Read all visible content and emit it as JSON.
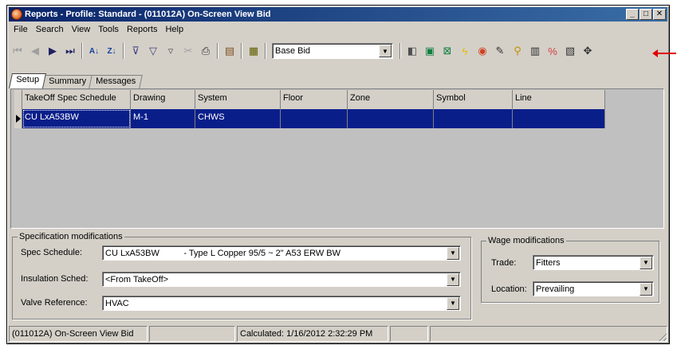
{
  "window": {
    "title": "Reports - Profile: Standard - (011012A) On-Screen View Bid",
    "minimize": "_",
    "maximize": "□",
    "close": "✕"
  },
  "menu": [
    "File",
    "Search",
    "View",
    "Tools",
    "Reports",
    "Help"
  ],
  "toolbar": {
    "bid_select_value": "Base Bid",
    "nav_icons": [
      "first-record-icon",
      "prev-record-icon",
      "next-record-icon",
      "last-record-icon"
    ],
    "tool_icons": [
      "sort-ascending-icon",
      "sort-descending-icon",
      "filter-add-icon",
      "filter-icon",
      "filter-edit-icon",
      "filter-remove-icon",
      "print-icon",
      "export-icon",
      "calculator-icon"
    ],
    "right_icons": [
      "properties-icon",
      "excel-export-icon",
      "spreadsheet-icon",
      "lightning-icon",
      "globe-icon",
      "edit-icon",
      "magnify-icon",
      "grid-icon",
      "percent-icon",
      "document-icon",
      "crosshair-icon"
    ]
  },
  "tabs": [
    "Setup",
    "Summary",
    "Messages"
  ],
  "active_tab": "Setup",
  "grid": {
    "columns": [
      "TakeOff Spec Schedule",
      "Drawing",
      "System",
      "Floor",
      "Zone",
      "Symbol",
      "Line"
    ],
    "rows": [
      [
        "CU LxA53BW",
        "M-1",
        "CHWS",
        "",
        "",
        "",
        ""
      ]
    ]
  },
  "spec_mods": {
    "group_label": "Specification modifications",
    "spec_schedule_label": "Spec Schedule:",
    "spec_schedule_value": "CU LxA53BW          - Type L Copper 95/5 ~ 2\" A53 ERW BW",
    "insulation_label": "Insulation Sched:",
    "insulation_value": "<From TakeOff>",
    "valve_label": "Valve Reference:",
    "valve_value": "HVAC"
  },
  "wage_mods": {
    "group_label": "Wage modifications",
    "trade_label": "Trade:",
    "trade_value": "Fitters",
    "location_label": "Location:",
    "location_value": "Prevailing"
  },
  "status": {
    "bid": "(011012A) On-Screen View Bid",
    "calculated": "Calculated: 1/16/2012 2:32:29 PM"
  },
  "colors": {
    "selection": "#0a1e8a",
    "titlebar_start": "#0a246a",
    "titlebar_end": "#3a6ea5",
    "annotation_arrow": "#e00000"
  }
}
